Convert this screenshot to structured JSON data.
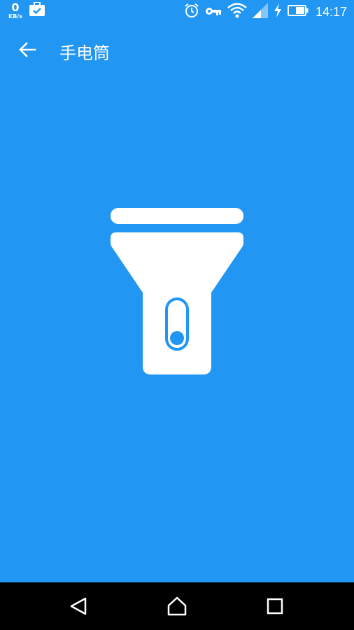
{
  "status_bar": {
    "speed_value": "0",
    "speed_unit": "KB/s",
    "time": "14:17",
    "icons": [
      "briefcase-check-icon",
      "alarm-icon",
      "key-icon",
      "wifi-icon",
      "cell-signal-icon",
      "charging-bolt-icon",
      "battery-icon"
    ]
  },
  "app_bar": {
    "back_icon": "arrow-left-icon",
    "title": "手电筒"
  },
  "main": {
    "toggle_icon": "flashlight-icon",
    "switch_state": "off"
  },
  "nav_bar": {
    "icons": [
      "nav-back-icon",
      "nav-home-icon",
      "nav-recents-icon"
    ]
  },
  "colors": {
    "primary": "#2196F3",
    "on_primary": "#FFFFFF",
    "nav_bar": "#000000"
  }
}
